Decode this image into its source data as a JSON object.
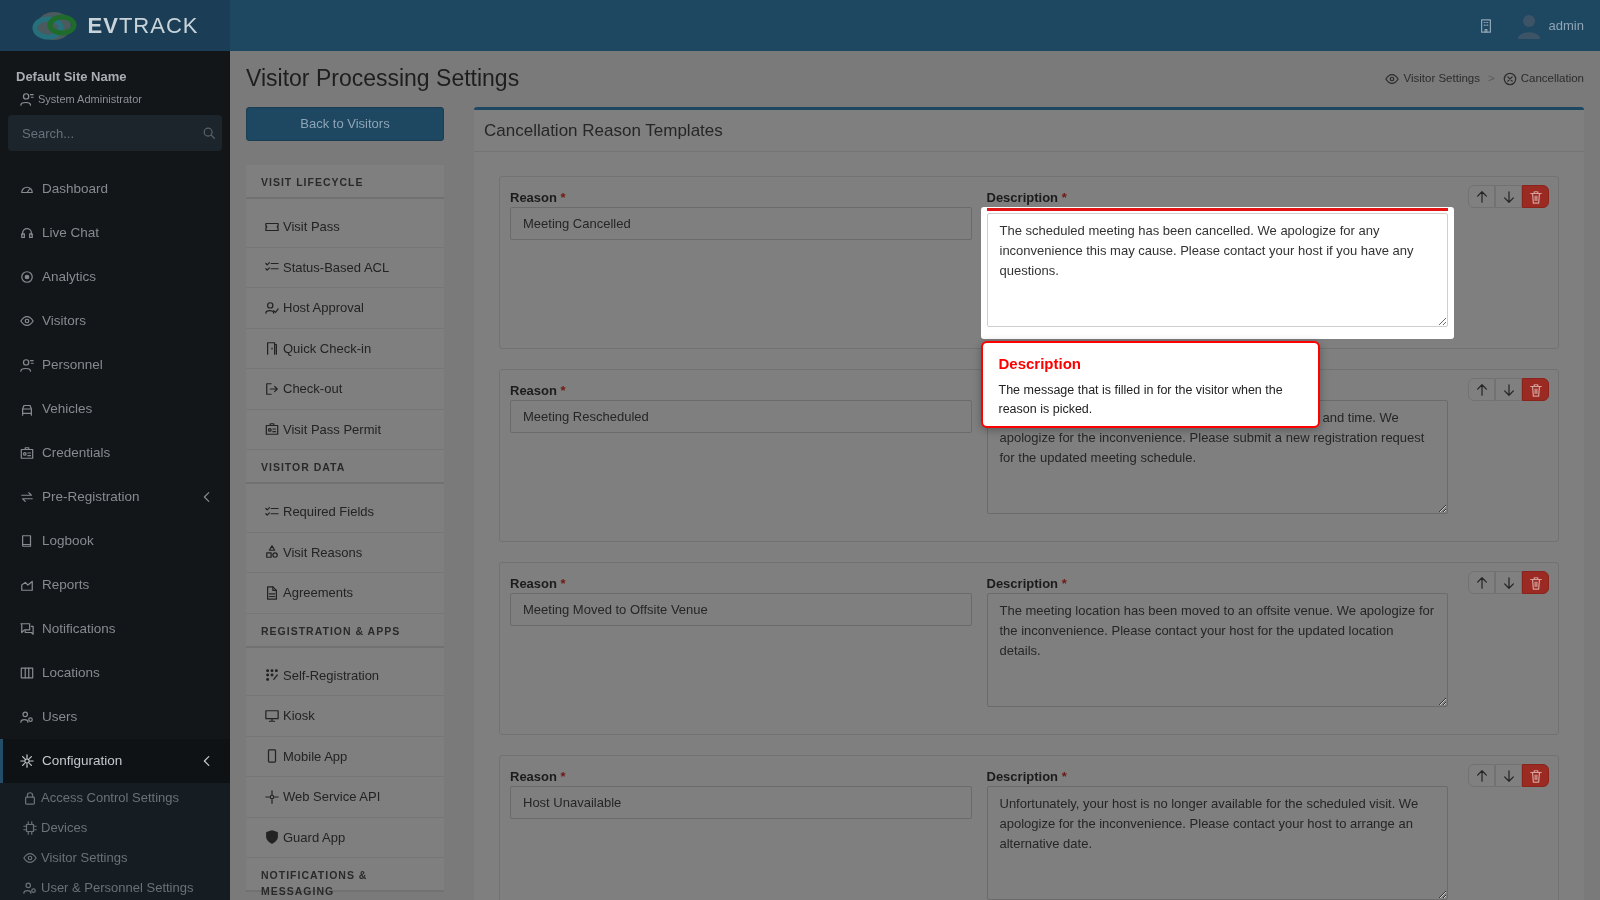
{
  "header": {
    "logo": "**EV**TRACK",
    "user": "admin"
  },
  "sidebar": {
    "site_name": "Default Site Name",
    "role": "System Administrator",
    "search": {
      "placeholder": "Search..."
    },
    "items": [
      {
        "label": "Dashboard",
        "selected": false,
        "expandable": false
      },
      {
        "label": "Live Chat",
        "selected": false,
        "expandable": false
      },
      {
        "label": "Analytics",
        "selected": false,
        "expandable": false
      },
      {
        "label": "Visitors",
        "selected": false,
        "expandable": false
      },
      {
        "label": "Personnel",
        "selected": false,
        "expandable": false
      },
      {
        "label": "Vehicles",
        "selected": false,
        "expandable": false
      },
      {
        "label": "Credentials",
        "selected": false,
        "expandable": false
      },
      {
        "label": "Pre-Registration",
        "selected": false,
        "expandable": true
      },
      {
        "label": "Logbook",
        "selected": false,
        "expandable": false
      },
      {
        "label": "Reports",
        "selected": false,
        "expandable": false
      },
      {
        "label": "Notifications",
        "selected": false,
        "expandable": false
      },
      {
        "label": "Locations",
        "selected": false,
        "expandable": false
      },
      {
        "label": "Users",
        "selected": false,
        "expandable": false
      },
      {
        "label": "Configuration",
        "selected": true,
        "expandable": true,
        "children": [
          {
            "label": "Access Control Settings"
          },
          {
            "label": "Devices"
          },
          {
            "label": "Visitor Settings"
          },
          {
            "label": "User & Personnel Settings"
          }
        ]
      }
    ]
  },
  "page": {
    "title": "Visitor Processing Settings",
    "breadcrumb": [
      {
        "label": "Visitor Settings"
      },
      {
        "label": "Cancellation"
      }
    ],
    "breadcrumb_separator": ">"
  },
  "subnav": {
    "back_button": "Back to Visitors",
    "sections": [
      {
        "heading": "VISIT LIFECYCLE",
        "items": [
          {
            "label": "Visit Pass"
          },
          {
            "label": "Status-Based ACL"
          },
          {
            "label": "Host Approval"
          },
          {
            "label": "Quick Check-in"
          },
          {
            "label": "Check-out"
          },
          {
            "label": "Visit Pass Permit"
          }
        ]
      },
      {
        "heading": "VISITOR DATA",
        "items": [
          {
            "label": "Required Fields"
          },
          {
            "label": "Visit Reasons"
          },
          {
            "label": "Agreements"
          }
        ]
      },
      {
        "heading": "REGISTRATION & APPS",
        "items": [
          {
            "label": "Self-Registration"
          },
          {
            "label": "Kiosk"
          },
          {
            "label": "Mobile App"
          },
          {
            "label": "Web Service API"
          },
          {
            "label": "Guard App"
          }
        ]
      },
      {
        "heading": "NOTIFICATIONS & MESSAGING"
      }
    ]
  },
  "templates": {
    "title": "Cancellation Reason Templates",
    "reasons": [
      {
        "reason_label": "Reason",
        "reason_mark": "*",
        "reason": "Meeting Cancelled",
        "description_label": "Description",
        "description_mark": "*",
        "description": "The scheduled meeting has been cancelled. We apologize for any inconvenience this may cause. Please contact your host if you have any questions.",
        "highlighted": true
      },
      {
        "reason_label": "Reason",
        "reason_mark": "*",
        "reason": "Meeting Rescheduled",
        "description": "and time. We apologize for the inconvenience. Please submit a new registration request for the updated meeting schedule.",
        "highlighted": false
      },
      {
        "reason_label": "Reason",
        "reason_mark": "*",
        "reason": "Meeting Moved to Offsite Venue",
        "description_label": "Description",
        "description_mark": "*",
        "description": "The meeting location has been moved to an offsite venue. We apologize for the inconvenience. Please contact your host for the updated location details.",
        "highlighted": false
      },
      {
        "reason_label": "Reason",
        "reason_mark": "*",
        "reason": "Host Unavailable",
        "description_label": "Description",
        "description_mark": "*",
        "description": "Unfortunately, your host is no longer available for the scheduled visit. We apologize for the inconvenience. Please contact your host to arrange an alternative date.",
        "highlighted": false
      }
    ]
  },
  "tooltip": {
    "title": "Description",
    "text": "The message that is filled in for the visitor when the reason is picked."
  }
}
